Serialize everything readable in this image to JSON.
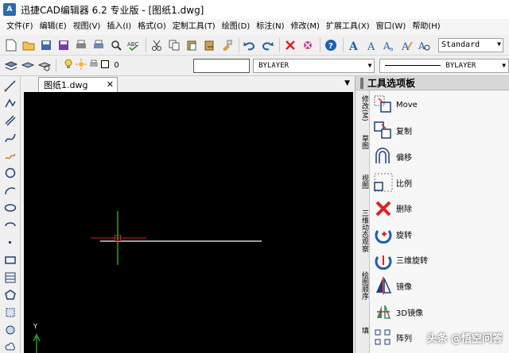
{
  "titlebar": {
    "app_icon_text": "A",
    "title": "迅捷CAD编辑器 6.2 专业版 - [图纸1.dwg]"
  },
  "menu": [
    "文件(F)",
    "编辑(E)",
    "视图(V)",
    "插入(I)",
    "格式(O)",
    "定制工具(T)",
    "绘图(D)",
    "标注(N)",
    "修改(M)",
    "扩展工具(X)",
    "窗口(W)",
    "帮助(H)"
  ],
  "toolbar": {
    "text_style": "Standard"
  },
  "properties": {
    "layer_value": "0",
    "color_value": "BYLAYER",
    "linetype_value": "BYLAYER"
  },
  "document": {
    "tab_title": "图纸1.dwg",
    "close_glyph": "✕"
  },
  "canvas": {
    "ucs_y_label": "Y"
  },
  "palette": {
    "title": "工具选项板",
    "tabs": [
      "修改(M)",
      "草图",
      "视图",
      "三维动态观察",
      "绘图顺序",
      "填"
    ],
    "items": [
      {
        "label": "Move",
        "icon": "move-icon"
      },
      {
        "label": "复制",
        "icon": "copy-icon"
      },
      {
        "label": "偏移",
        "icon": "offset-icon"
      },
      {
        "label": "比例",
        "icon": "scale-icon"
      },
      {
        "label": "删除",
        "icon": "delete-icon"
      },
      {
        "label": "旋转",
        "icon": "rotate-icon"
      },
      {
        "label": "三维旋转",
        "icon": "rotate-3d-icon"
      },
      {
        "label": "镜像",
        "icon": "mirror-icon"
      },
      {
        "label": "3D镜像",
        "icon": "mirror-3d-icon"
      },
      {
        "label": "阵列",
        "icon": "array-icon"
      }
    ]
  },
  "watermark": "头条 @悟空问答",
  "colors": {
    "canvas_bg": "#000000",
    "crosshair_red": "#cc2020",
    "crosshair_green": "#2aa02a",
    "line": "#cfcfcf",
    "delete_red": "#e02020",
    "icon_blue": "#1f5fb0"
  }
}
